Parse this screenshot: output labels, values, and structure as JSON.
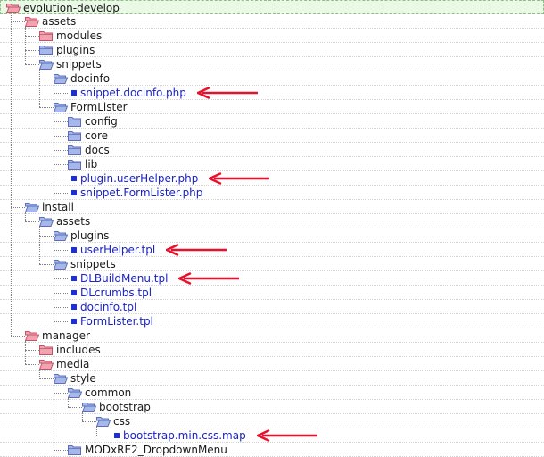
{
  "tree": {
    "items": [
      {
        "name": "evolution-develop",
        "type": "folder",
        "depth": 0,
        "open": true,
        "color": "pink",
        "last": false
      },
      {
        "name": "assets",
        "type": "folder",
        "depth": 1,
        "open": true,
        "color": "pink",
        "last": false
      },
      {
        "name": "modules",
        "type": "folder",
        "depth": 2,
        "open": false,
        "color": "pink",
        "last": false
      },
      {
        "name": "plugins",
        "type": "folder",
        "depth": 2,
        "open": false,
        "color": "blue",
        "last": false
      },
      {
        "name": "snippets",
        "type": "folder",
        "depth": 2,
        "open": true,
        "color": "blue",
        "last": true
      },
      {
        "name": "docinfo",
        "type": "folder",
        "depth": 3,
        "open": true,
        "color": "blue",
        "last": false
      },
      {
        "name": "snippet.docinfo.php",
        "type": "file",
        "depth": 4,
        "last": true,
        "arrow": true
      },
      {
        "name": "FormLister",
        "type": "folder",
        "depth": 3,
        "open": true,
        "color": "blue",
        "last": true
      },
      {
        "name": "config",
        "type": "folder",
        "depth": 4,
        "open": false,
        "color": "blue",
        "last": false
      },
      {
        "name": "core",
        "type": "folder",
        "depth": 4,
        "open": false,
        "color": "blue",
        "last": false
      },
      {
        "name": "docs",
        "type": "folder",
        "depth": 4,
        "open": false,
        "color": "blue",
        "last": false
      },
      {
        "name": "lib",
        "type": "folder",
        "depth": 4,
        "open": false,
        "color": "blue",
        "last": false
      },
      {
        "name": "plugin.userHelper.php",
        "type": "file",
        "depth": 4,
        "last": false,
        "arrow": true
      },
      {
        "name": "snippet.FormLister.php",
        "type": "file",
        "depth": 4,
        "last": true
      },
      {
        "name": "install",
        "type": "folder",
        "depth": 1,
        "open": true,
        "color": "blue",
        "last": false
      },
      {
        "name": "assets",
        "type": "folder",
        "depth": 2,
        "open": true,
        "color": "blue",
        "last": true
      },
      {
        "name": "plugins",
        "type": "folder",
        "depth": 3,
        "open": true,
        "color": "blue",
        "last": false
      },
      {
        "name": "userHelper.tpl",
        "type": "file",
        "depth": 4,
        "last": true,
        "arrow": true
      },
      {
        "name": "snippets",
        "type": "folder",
        "depth": 3,
        "open": true,
        "color": "blue",
        "last": true
      },
      {
        "name": "DLBuildMenu.tpl",
        "type": "file",
        "depth": 4,
        "last": false,
        "arrow": true
      },
      {
        "name": "DLcrumbs.tpl",
        "type": "file",
        "depth": 4,
        "last": false
      },
      {
        "name": "docinfo.tpl",
        "type": "file",
        "depth": 4,
        "last": false
      },
      {
        "name": "FormLister.tpl",
        "type": "file",
        "depth": 4,
        "last": true
      },
      {
        "name": "manager",
        "type": "folder",
        "depth": 1,
        "open": true,
        "color": "pink",
        "last": true
      },
      {
        "name": "includes",
        "type": "folder",
        "depth": 2,
        "open": false,
        "color": "pink",
        "last": false
      },
      {
        "name": "media",
        "type": "folder",
        "depth": 2,
        "open": true,
        "color": "pink",
        "last": true
      },
      {
        "name": "style",
        "type": "folder",
        "depth": 3,
        "open": true,
        "color": "blue",
        "last": true
      },
      {
        "name": "common",
        "type": "folder",
        "depth": 4,
        "open": true,
        "color": "blue",
        "last": false
      },
      {
        "name": "bootstrap",
        "type": "folder",
        "depth": 5,
        "open": true,
        "color": "blue",
        "last": true
      },
      {
        "name": "css",
        "type": "folder",
        "depth": 6,
        "open": true,
        "color": "blue",
        "last": true
      },
      {
        "name": "bootstrap.min.css.map",
        "type": "file",
        "depth": 7,
        "last": true,
        "arrow": true
      },
      {
        "name": "MODxRE2_DropdownMenu",
        "type": "folder",
        "depth": 4,
        "open": false,
        "color": "blue",
        "last": false
      }
    ]
  },
  "colors": {
    "arrow": "#e8112d",
    "file_text": "#1a22c8",
    "file_icon": "#1c2fd8",
    "pink_folder": "#f2a3b0",
    "blue_folder": "#a7b7ea",
    "root_highlight": "#eaf9e6"
  }
}
